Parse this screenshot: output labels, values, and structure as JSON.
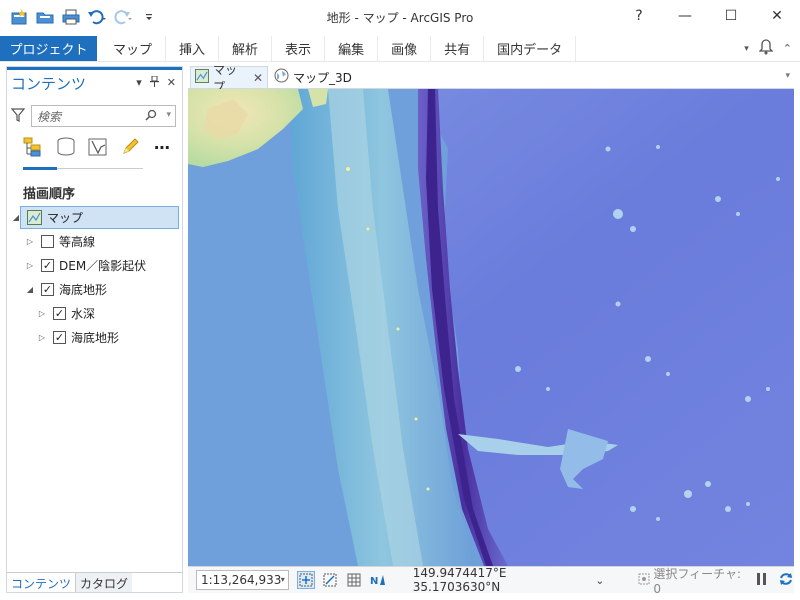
{
  "window": {
    "title": "地形 - マップ - ArcGIS Pro",
    "help": "?",
    "minimize": "—",
    "maximize": "☐",
    "close": "✕"
  },
  "qat": [
    "new-project-icon",
    "open-folder-icon",
    "print-icon",
    "undo-icon",
    "redo-icon",
    "customize-icon"
  ],
  "ribbon": {
    "project_tab": "プロジェクト",
    "tabs": [
      "マップ",
      "挿入",
      "解析",
      "表示",
      "編集",
      "画像",
      "共有",
      "国内データ"
    ]
  },
  "contents": {
    "title": "コンテンツ",
    "search_placeholder": "検索",
    "section_label": "描画順序",
    "tree": [
      {
        "label": "マップ",
        "level": 0,
        "type": "map",
        "expanded": true,
        "selected": true
      },
      {
        "label": "等高線",
        "level": 1,
        "checked": false,
        "expanded": false
      },
      {
        "label": "DEM／陰影起伏",
        "level": 1,
        "checked": true,
        "expanded": false
      },
      {
        "label": "海底地形",
        "level": 1,
        "checked": true,
        "expanded": true
      },
      {
        "label": "水深",
        "level": 2,
        "checked": true,
        "expanded": false
      },
      {
        "label": "海底地形",
        "level": 2,
        "checked": true,
        "expanded": false
      }
    ],
    "bottom_tabs": [
      "コンテンツ",
      "カタログ"
    ]
  },
  "map": {
    "tabs": [
      {
        "label": "マップ",
        "active": true
      },
      {
        "label": "マップ_3D",
        "active": false
      }
    ],
    "scale": "1:13,264,933",
    "coordinates": "149.9474417°E 35.1703630°N",
    "selected_features": "選択フィーチャ: 0"
  }
}
